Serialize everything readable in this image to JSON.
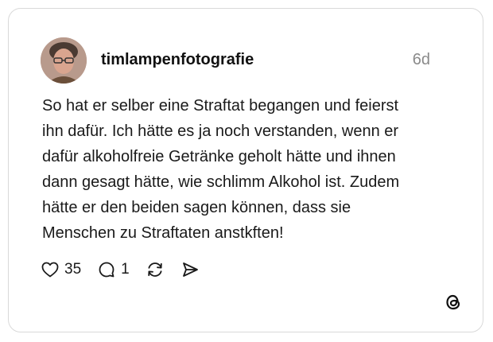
{
  "post": {
    "username": "timlampenfotografie",
    "timestamp": "6d",
    "text_lines": [
      "So hat er selber eine Straftat begangen und feierst",
      "ihn dafür. Ich hätte es ja noch verstanden, wenn er",
      "dafür alkoholfreie Getränke geholt hätte und ihnen",
      "dann gesagt hätte, wie schlimm Alkohol ist. Zudem",
      "hätte er den beiden sagen können, dass sie",
      "Menschen zu Straftaten anstkften!"
    ]
  },
  "actions": {
    "likes": "35",
    "replies": "1",
    "like_icon": "heart-icon",
    "reply_icon": "speech-bubble-icon",
    "repost_icon": "repost-icon",
    "share_icon": "send-icon"
  },
  "branding": {
    "logo_icon": "threads-logo-icon"
  }
}
